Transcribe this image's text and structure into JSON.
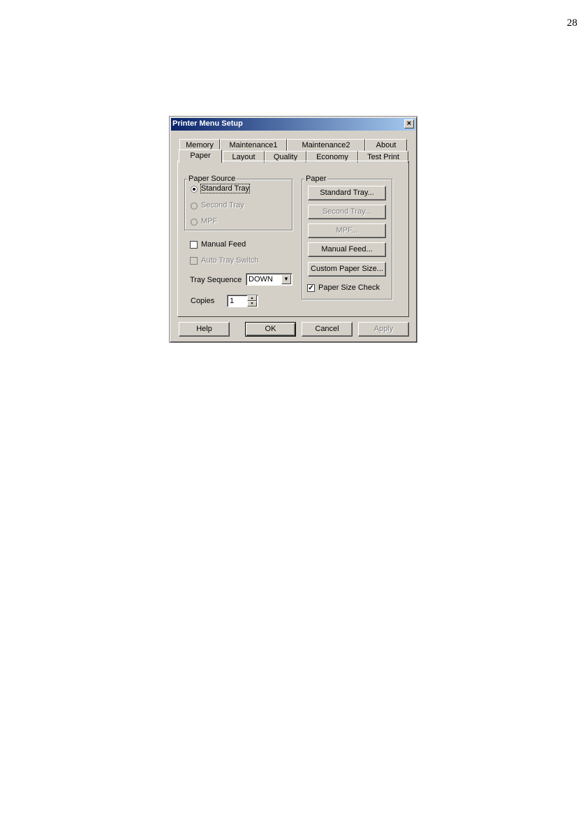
{
  "page_number": "28",
  "dialog": {
    "title": "Printer Menu Setup",
    "close_glyph": "×"
  },
  "tabs": {
    "back_row": [
      "Memory",
      "Maintenance1",
      "Maintenance2",
      "About"
    ],
    "front_row": [
      "Paper",
      "Layout",
      "Quality",
      "Economy",
      "Test Print"
    ],
    "active": "Paper"
  },
  "paper_source": {
    "label": "Paper Source",
    "options": [
      {
        "label": "Standard Tray",
        "selected": true,
        "enabled": true
      },
      {
        "label": "Second Tray",
        "selected": false,
        "enabled": false
      },
      {
        "label": "MPF",
        "selected": false,
        "enabled": false
      }
    ]
  },
  "manual_feed": {
    "label": "Manual Feed",
    "checked": false
  },
  "auto_tray_switch": {
    "label": "Auto Tray Switch",
    "checked": false,
    "enabled": false
  },
  "tray_sequence": {
    "label": "Tray Sequence",
    "value": "DOWN"
  },
  "copies": {
    "label": "Copies",
    "value": "1"
  },
  "paper_group": {
    "label": "Paper",
    "buttons": [
      {
        "label": "Standard Tray...",
        "enabled": true
      },
      {
        "label": "Second Tray...",
        "enabled": false
      },
      {
        "label": "MPF...",
        "enabled": false
      },
      {
        "label": "Manual Feed...",
        "enabled": true
      },
      {
        "label": "Custom Paper Size...",
        "enabled": true
      }
    ],
    "paper_size_check": {
      "label": "Paper Size Check",
      "checked": true
    }
  },
  "footer": {
    "help": "Help",
    "ok": "OK",
    "cancel": "Cancel",
    "apply": "Apply"
  },
  "colors": {
    "face": "#d4d0c8",
    "title_start": "#0a246a",
    "title_end": "#a6caf0"
  }
}
